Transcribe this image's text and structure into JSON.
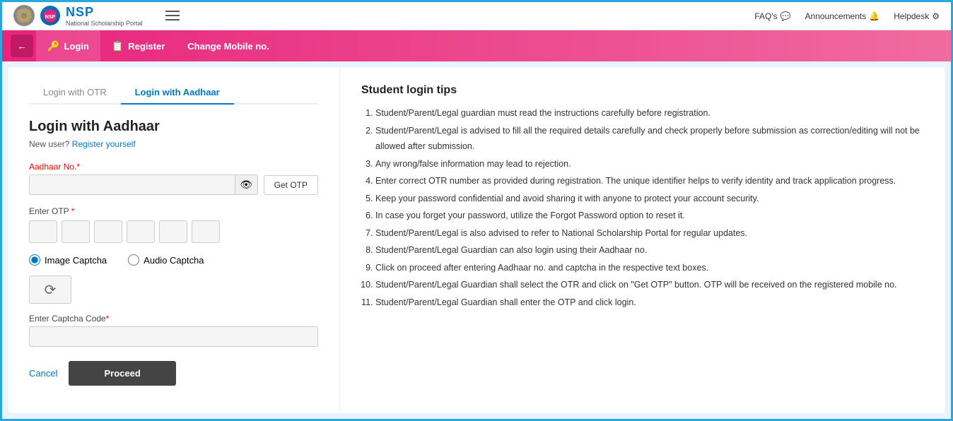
{
  "header": {
    "emblem_label": "GOV",
    "nsp_abbr": "NSP",
    "nsp_full": "National Scholarship Portal",
    "hamburger_label": "menu",
    "faq_label": "FAQ's",
    "announcements_label": "Announcements",
    "helpdesk_label": "Helpdesk"
  },
  "pink_nav": {
    "back_label": "←",
    "tabs": [
      {
        "id": "login",
        "label": "Login",
        "icon": "🔑",
        "active": true
      },
      {
        "id": "register",
        "label": "Register",
        "icon": "📋",
        "active": false
      },
      {
        "id": "change-mobile",
        "label": "Change Mobile no.",
        "icon": "",
        "active": false
      }
    ]
  },
  "login_form": {
    "tab_otr": "Login with OTR",
    "tab_aadhaar": "Login with Aadhaar",
    "title": "Login with Aadhaar",
    "new_user_text": "New user?",
    "register_link_text": "Register yourself",
    "aadhaar_label": "Aadhaar No.",
    "aadhaar_required": "*",
    "aadhaar_placeholder": "",
    "get_otp_label": "Get OTP",
    "otp_label": "Enter OTP",
    "otp_required": "*",
    "otp_boxes": [
      "",
      "",
      "",
      "",
      "",
      ""
    ],
    "captcha_image_label": "Image Captcha",
    "captcha_audio_label": "Audio Captcha",
    "captcha_code_label": "Enter Captcha Code",
    "captcha_code_required": "*",
    "captcha_code_placeholder": "",
    "cancel_label": "Cancel",
    "proceed_label": "Proceed"
  },
  "tips": {
    "title": "Student login tips",
    "items": [
      "Student/Parent/Legal guardian must read the instructions carefully before registration.",
      "Student/Parent/Legal is advised to fill all the required details carefully and check properly before submission as correction/editing will not be allowed after submission.",
      "Any wrong/false information may lead to rejection.",
      "Enter correct OTR number as provided during registration. The unique identifier helps to verify identity and track application progress.",
      "Keep your password confidential and avoid sharing it with anyone to protect your account security.",
      "In case you forget your password, utilize the Forgot Password option to reset it.",
      "Student/Parent/Legal is also advised to refer to National Scholarship Portal for regular updates.",
      "Student/Parent/Legal Guardian can also login using their Aadhaar no.",
      "Click on proceed after entering Aadhaar no. and captcha in the respective text boxes.",
      "Student/Parent/Legal Guardian shall select the OTR and click on \"Get OTP\" button. OTP will be received on the registered mobile no.",
      "Student/Parent/Legal Guardian shall enter the OTP and click login."
    ]
  }
}
